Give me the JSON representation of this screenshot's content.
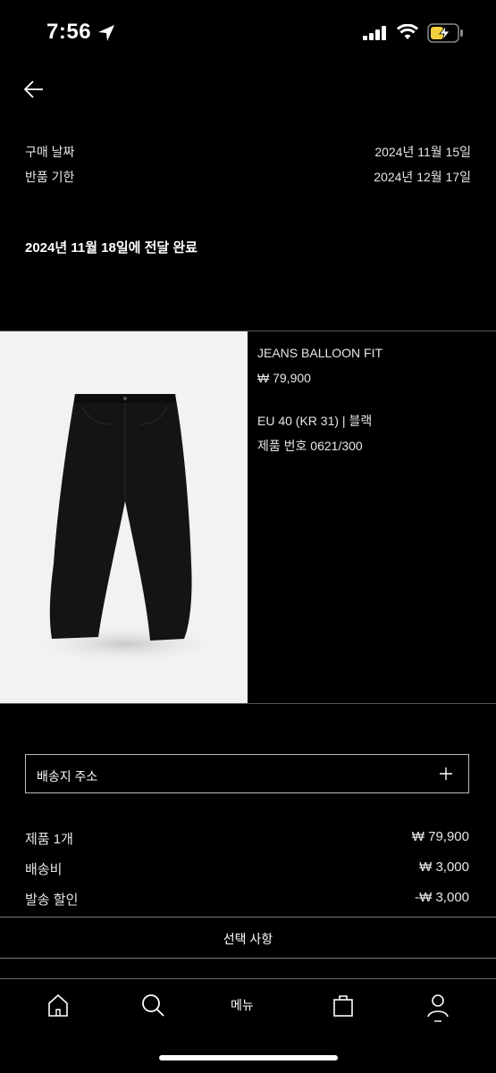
{
  "status_bar": {
    "time": "7:56"
  },
  "order": {
    "purchase_date_label": "구매 날짜",
    "purchase_date_value": "2024년 11월 15일",
    "return_deadline_label": "반품 기한",
    "return_deadline_value": "2024년 12월 17일",
    "delivery_status": "2024년 11월 18일에 전달 완료"
  },
  "product": {
    "name": "JEANS BALLOON FIT",
    "price": "₩ 79,900",
    "size_color": "EU 40 (KR 31) | 블랙",
    "product_number": "제품 번호 0621/300",
    "image_icon": "jeans-image"
  },
  "address": {
    "label": "배송지 주소"
  },
  "summary": {
    "items_label": "제품 1개",
    "items_value": "₩ 79,900",
    "shipping_label": "배송비",
    "shipping_value": "₩ 3,000",
    "discount_label": "발송 할인",
    "discount_value": "-₩ 3,000"
  },
  "options": {
    "label": "선택 사항"
  },
  "tab_bar": {
    "menu_label": "메뉴"
  }
}
